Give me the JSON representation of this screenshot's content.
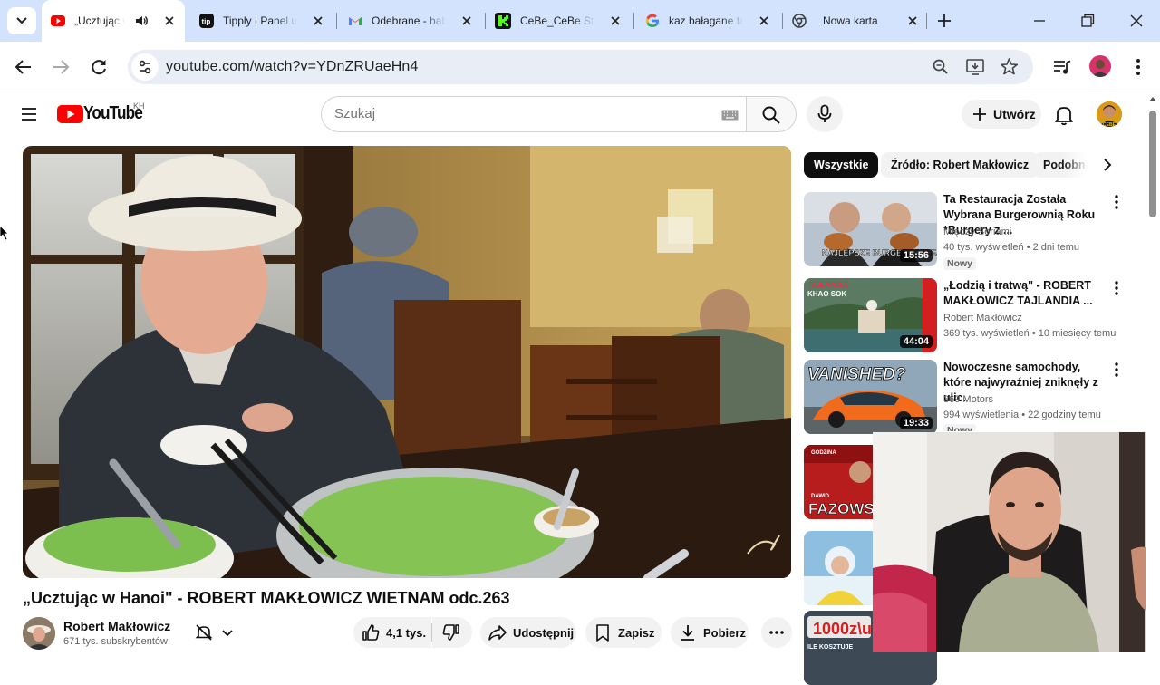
{
  "browser": {
    "tabs": [
      {
        "label": "„Ucztując w Hanoi\"",
        "icon": "youtube-icon",
        "active": true
      },
      {
        "label": "Tipply | Panel użytkownika",
        "icon": "tipply-icon",
        "active": false
      },
      {
        "label": "Odebrane - baby",
        "icon": "gmail-icon",
        "active": false
      },
      {
        "label": "CeBe_CeBe Stream",
        "icon": "kick-icon",
        "active": false
      },
      {
        "label": "kaz bałagane face",
        "icon": "google-icon",
        "active": false
      },
      {
        "label": "Nowa karta",
        "icon": "chrome-icon",
        "active": false
      }
    ],
    "url": "youtube.com/watch?v=YDnZRUaeHn4"
  },
  "youtube": {
    "logo_text": "YouTube",
    "country_code": "KH",
    "search_placeholder": "Szukaj",
    "create_label": "Utwórz"
  },
  "video": {
    "title": "„Ucztując w Hanoi\" - ROBERT MAKŁOWICZ WIETNAM odc.263",
    "channel": "Robert Makłowicz",
    "subscribers": "671 tys. subskrybentów",
    "likes": "4,1 tys.",
    "share_label": "Udostępnij",
    "save_label": "Zapisz",
    "download_label": "Pobierz"
  },
  "chips": [
    {
      "label": "Wszystkie",
      "active": true
    },
    {
      "label": "Źródło: Robert Makłowicz",
      "active": false
    },
    {
      "label": "Podobne",
      "active": false
    }
  ],
  "recommended": [
    {
      "title": "Ta Restauracja Została Wybrana Burgerownią Roku *Burgery z ...",
      "channel": "Między Seriami",
      "meta": "40 tys. wyświetleń • 2 dni temu",
      "badge": "Nowy",
      "duration": "15:56",
      "thumb_text": "NAJLEPSZE BURGE W CAŁEJ POLSC"
    },
    {
      "title": "„Łodzią i tratwą\" - ROBERT MAKŁOWICZ TAJLANDIA ...",
      "channel": "Robert Makłowicz",
      "meta": "369 tys. wyświetleń • 10 miesięcy temu",
      "badge": "",
      "duration": "44:04",
      "thumb_text": "TAJLANDIA KHAO SOK"
    },
    {
      "title": "Nowoczesne samochody, które najwyraźniej zniknęły z ulic.",
      "channel": "369 Motors",
      "meta": "994 wyświetlenia • 22 godziny temu",
      "badge": "Nowy",
      "duration": "19:33",
      "thumb_text": "VANISHED?"
    },
    {
      "title": "",
      "channel": "",
      "meta": "",
      "badge": "",
      "duration": "",
      "thumb_text": "GODZINA DAWID FAZOWS"
    },
    {
      "title": "",
      "channel": "",
      "meta": "",
      "badge": "",
      "duration": "",
      "thumb_text": ""
    },
    {
      "title": "",
      "channel": "",
      "meta": "",
      "badge": "",
      "duration": "",
      "thumb_text": "1000ZŁ ILE KOSZTUJE"
    }
  ],
  "colors": {
    "tabstrip": "#d3e3fd",
    "youtube_red": "#ff0000",
    "text_primary": "#0f0f0f",
    "text_secondary": "#606060"
  }
}
